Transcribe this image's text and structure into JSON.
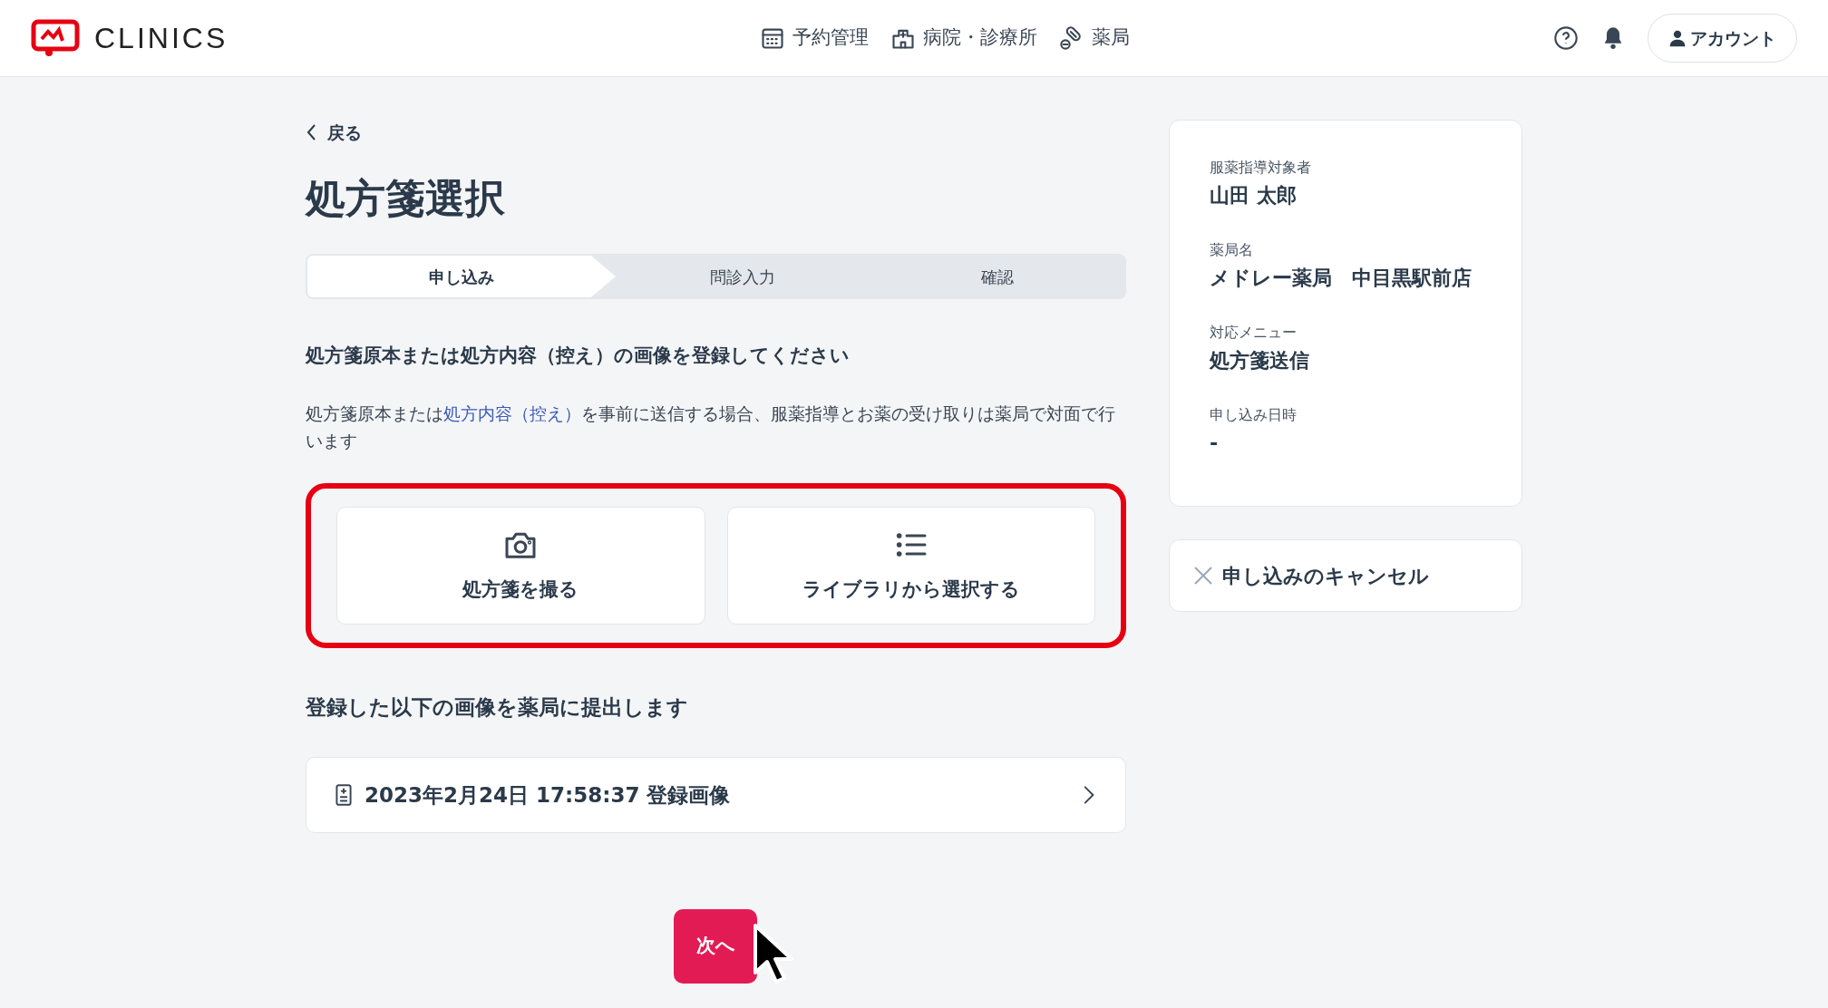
{
  "header": {
    "logo_text": "CLINICS",
    "nav": [
      {
        "label": "予約管理",
        "kind": "calendar"
      },
      {
        "label": "病院・診療所",
        "kind": "hospital"
      },
      {
        "label": "薬局",
        "kind": "pill"
      }
    ],
    "account_label": "アカウント"
  },
  "back_label": "戻る",
  "title": "処方箋選択",
  "steps": [
    {
      "label": "申し込み",
      "selected": true
    },
    {
      "label": "問診入力",
      "selected": false
    },
    {
      "label": "確認",
      "selected": false
    }
  ],
  "instruction": "処方箋原本または処方内容（控え）の画像を登録してください",
  "description": {
    "before": "処方箋原本または",
    "link": "処方内容（控え）",
    "after": "を事前に送信する場合、服薬指導とお薬の受け取りは薬局で対面で行います"
  },
  "upload_options": [
    {
      "label": "処方箋を撮る",
      "kind": "camera"
    },
    {
      "label": "ライブラリから選択する",
      "kind": "list"
    }
  ],
  "submitted_heading": "登録した以下の画像を薬局に提出します",
  "images": [
    {
      "label": "2023年2月24日 17:58:37 登録画像"
    }
  ],
  "summary": [
    {
      "label": "服薬指導対象者",
      "value": "山田 太郎"
    },
    {
      "label": "薬局名",
      "value": "メドレー薬局　中目黒駅前店"
    },
    {
      "label": "対応メニュー",
      "value": "処方箋送信"
    },
    {
      "label": "申し込み日時",
      "value": "-"
    }
  ],
  "cancel_label": "申し込みのキャンセル",
  "next_button": "次へ"
}
